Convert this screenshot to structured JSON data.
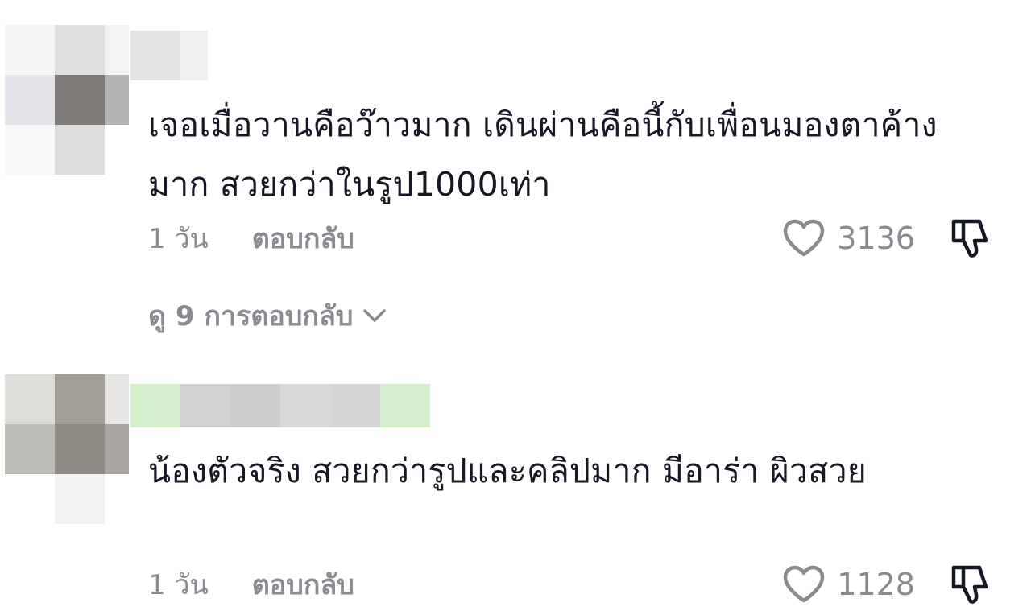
{
  "comments": [
    {
      "text": "เจอเมื่อวานคือว๊าวมาก เดินผ่านคือนี้กับเพื่อนมองตาค้างมาก สวยกว่าในรูป1000เท่า",
      "time": "1 วัน",
      "reply_label": "ตอบกลับ",
      "likes": "3136",
      "view_replies": "ดู 9 การตอบกลับ"
    },
    {
      "text": "น้องตัวจริง สวยกว่ารูปและคลิปมาก มีอาร่า ผิวสวย",
      "time": "1 วัน",
      "reply_label": "ตอบกลับ",
      "likes": "1128"
    }
  ],
  "icons": {
    "like": "heart-outline-icon",
    "dislike": "thumbs-down-outline-icon",
    "expand": "chevron-down-icon"
  },
  "colors": {
    "text": "#161823",
    "secondary": "#8a8b91",
    "background": "#ffffff"
  }
}
